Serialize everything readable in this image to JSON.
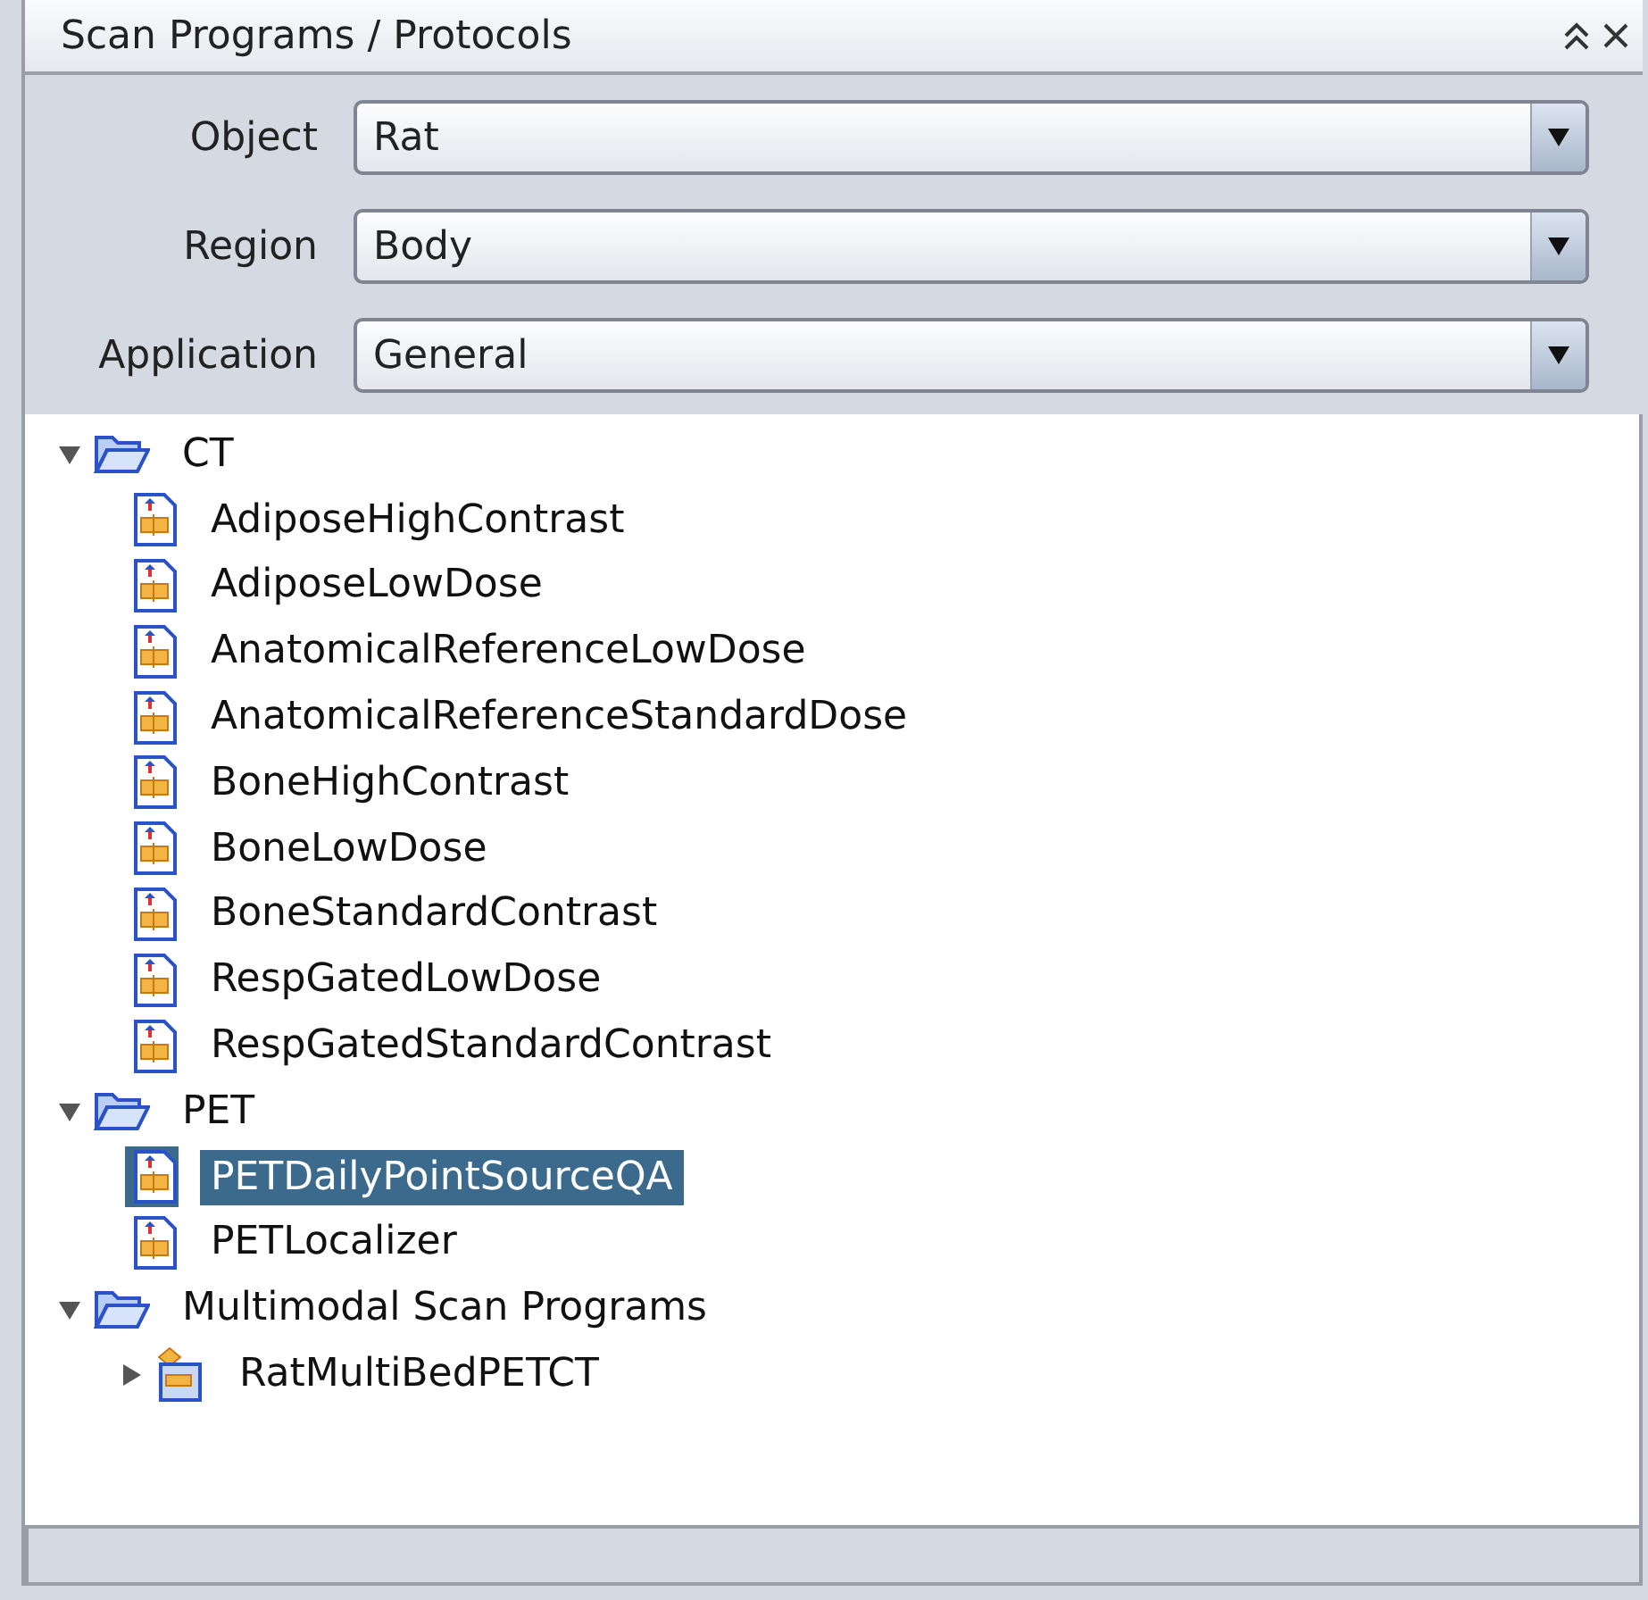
{
  "panel": {
    "title": "Scan Programs / Protocols"
  },
  "fields": [
    {
      "label": "Object",
      "value": "Rat"
    },
    {
      "label": "Region",
      "value": "Body"
    },
    {
      "label": "Application",
      "value": "General"
    }
  ],
  "tree": [
    {
      "kind": "folder",
      "label": "CT",
      "expanded": true,
      "selected": false,
      "children": [
        {
          "kind": "protocol",
          "label": "AdiposeHighContrast",
          "selected": false
        },
        {
          "kind": "protocol",
          "label": "AdiposeLowDose",
          "selected": false
        },
        {
          "kind": "protocol",
          "label": "AnatomicalReferenceLowDose",
          "selected": false
        },
        {
          "kind": "protocol",
          "label": "AnatomicalReferenceStandardDose",
          "selected": false
        },
        {
          "kind": "protocol",
          "label": "BoneHighContrast",
          "selected": false
        },
        {
          "kind": "protocol",
          "label": "BoneLowDose",
          "selected": false
        },
        {
          "kind": "protocol",
          "label": "BoneStandardContrast",
          "selected": false
        },
        {
          "kind": "protocol",
          "label": "RespGatedLowDose",
          "selected": false
        },
        {
          "kind": "protocol",
          "label": "RespGatedStandardContrast",
          "selected": false
        }
      ]
    },
    {
      "kind": "folder",
      "label": "PET",
      "expanded": true,
      "selected": false,
      "children": [
        {
          "kind": "protocol",
          "label": "PETDailyPointSourceQA",
          "selected": true
        },
        {
          "kind": "protocol",
          "label": "PETLocalizer",
          "selected": false
        }
      ]
    },
    {
      "kind": "folder",
      "label": "Multimodal Scan Programs",
      "expanded": true,
      "selected": false,
      "children": [
        {
          "kind": "program",
          "label": "RatMultiBedPETCT",
          "expanded": false,
          "selected": false
        }
      ]
    }
  ]
}
